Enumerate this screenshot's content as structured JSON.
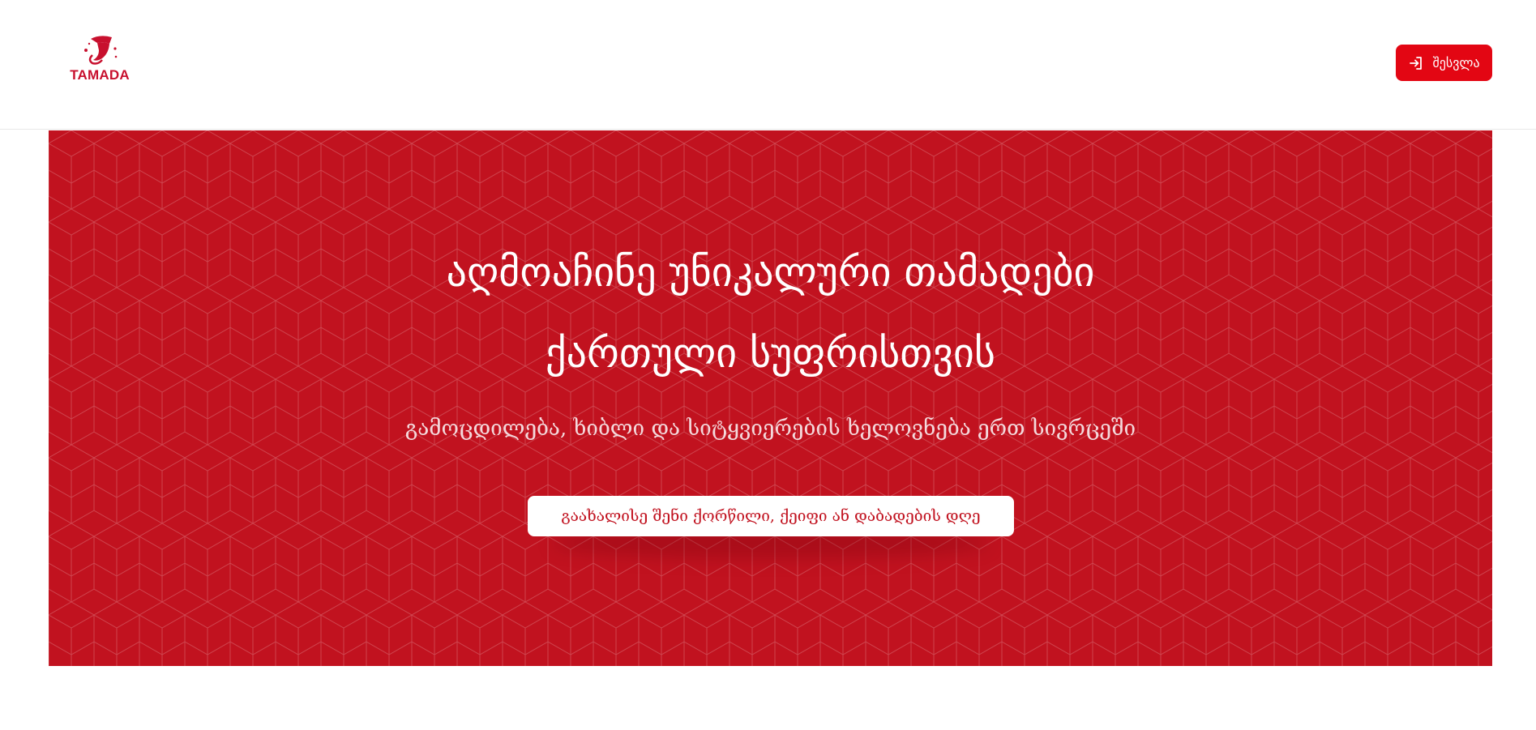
{
  "header": {
    "logo": {
      "text": "TAMADA",
      "icon": "wine-horn-icon"
    },
    "login_button": {
      "label": "შესვლა",
      "icon": "login-arrow-icon"
    }
  },
  "hero": {
    "title_line1": "აღმოაჩინე უნიკალური თამადები",
    "title_line2": "ქართული სუფრისთვის",
    "subtitle": "გამოცდილება, ხიბლი და სიტყვიერების ხელოვნება ერთ სივრცეში",
    "cta_label": "გაახალისე შენი ქორწილი, ქეიფი ან დაბადების დღე",
    "pattern": "hexagon-cube-pattern"
  },
  "colors": {
    "brand_red": "#e30613",
    "hero_red": "#c1121f",
    "logo_red": "#c8102e",
    "white": "#ffffff"
  }
}
